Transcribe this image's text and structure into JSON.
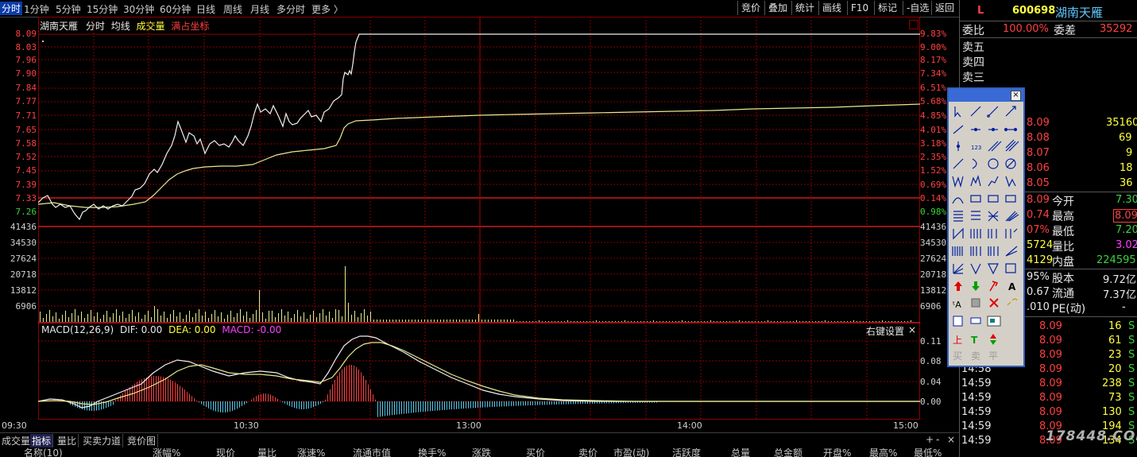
{
  "toolbar": {
    "periods": [
      "分时",
      "1分钟",
      "5分钟",
      "15分钟",
      "30分钟",
      "60分钟",
      "日线",
      "周线",
      "月线",
      "多分时",
      "更多 〉"
    ],
    "right_buttons": [
      "竞价",
      "叠加",
      "统计",
      "画线",
      "F10",
      "标记",
      "-自选",
      "返回"
    ]
  },
  "chart_header": {
    "stock_name": "湖南天雁",
    "mode": "分时",
    "avg_line": "均线",
    "volume": "成交量",
    "full_coord": "满占坐标"
  },
  "price_axis": {
    "left": [
      "8.09",
      "8.03",
      "7.96",
      "7.90",
      "7.84",
      "7.77",
      "7.71",
      "7.65",
      "7.58",
      "7.52",
      "7.45",
      "7.39",
      "7.33",
      "7.26"
    ],
    "right": [
      "9.83%",
      "9.00%",
      "8.17%",
      "7.34%",
      "6.51%",
      "5.68%",
      "4.85%",
      "4.01%",
      "3.18%",
      "2.35%",
      "1.52%",
      "0.69%",
      "0.14%",
      "0.98%"
    ]
  },
  "volume_axis": [
    "41436",
    "34530",
    "27624",
    "20718",
    "13812",
    "6906"
  ],
  "macd": {
    "label": "MACD(12,26,9)",
    "dif": "DIF: 0.00",
    "dea": "DEA: 0.00",
    "macd_val": "MACD: -0.00",
    "right_setting": "右键设置",
    "close_icon": "×",
    "axis": [
      "0.11",
      "0.08",
      "0.04",
      "0.00"
    ]
  },
  "time_axis": [
    "09:30",
    "10:30",
    "13:00",
    "14:00",
    "15:00"
  ],
  "bottom_tabs": [
    "成交量",
    "指标",
    "量比",
    "买卖力道",
    "竞价图"
  ],
  "bottom_controls": [
    "+",
    "-",
    "×"
  ],
  "column_headers": [
    "名称(10)",
    "涨幅%",
    "现价",
    "量比",
    "涨速%",
    "流通市值",
    "换手%",
    "涨跌",
    "买价",
    "卖价",
    "市盈(动)",
    "活跃度",
    "总量",
    "总金额",
    "开盘%",
    "最高%",
    "最低%"
  ],
  "quote": {
    "l_badge": "L",
    "code": "600698",
    "name": "湖南天雁",
    "weibi_label": "委比",
    "weibi_value": "100.00%",
    "weicha_label": "委差",
    "weicha_value": "35292",
    "sell_labels": [
      "卖五",
      "卖四",
      "卖三"
    ],
    "buy_rows": [
      {
        "price": "8.09",
        "vol": "35160"
      },
      {
        "price": "8.08",
        "vol": "69"
      },
      {
        "price": "8.07",
        "vol": "9"
      },
      {
        "price": "8.06",
        "vol": "18"
      },
      {
        "price": "8.05",
        "vol": "36"
      }
    ],
    "stats": [
      {
        "left": "8.09",
        "label": "今开",
        "value": "7.30"
      },
      {
        "left": "0.74",
        "label": "最高",
        "value": "8.09"
      },
      {
        "left": "07%",
        "label": "最低",
        "value": "7.20"
      },
      {
        "left": "5724",
        "label": "量比",
        "value": "3.02"
      },
      {
        "left": "4129",
        "label": "内盘",
        "value": "224595"
      },
      {
        "left": "95%",
        "label": "股本",
        "value": "9.72亿"
      },
      {
        "left": "0.67",
        "label": "流通",
        "value": "7.37亿"
      },
      {
        "left": ".010",
        "label": "PE(动)",
        "value": "-"
      }
    ],
    "ticks": [
      {
        "time": "",
        "price": "8.09",
        "vol": "16",
        "side": "S"
      },
      {
        "time": "",
        "price": "8.09",
        "vol": "61",
        "side": "S"
      },
      {
        "time": "",
        "price": "8.09",
        "vol": "23",
        "side": "S"
      },
      {
        "time": "14:58",
        "price": "8.09",
        "vol": "20",
        "side": "S"
      },
      {
        "time": "14:59",
        "price": "8.09",
        "vol": "238",
        "side": "S"
      },
      {
        "time": "14:59",
        "price": "8.09",
        "vol": "73",
        "side": "S"
      },
      {
        "time": "14:59",
        "price": "8.09",
        "vol": "130",
        "side": "S"
      },
      {
        "time": "14:59",
        "price": "8.09",
        "vol": "194",
        "side": "S"
      },
      {
        "time": "14:59",
        "price": "8.09",
        "vol": "134",
        "side": "S"
      }
    ]
  },
  "palette": {
    "close_icon": "×",
    "sell_label": "卖",
    "buy_label": "买",
    "flat_label": "平",
    "up_label": "上",
    "text_tool": "A"
  },
  "watermark": "178448.COM"
}
